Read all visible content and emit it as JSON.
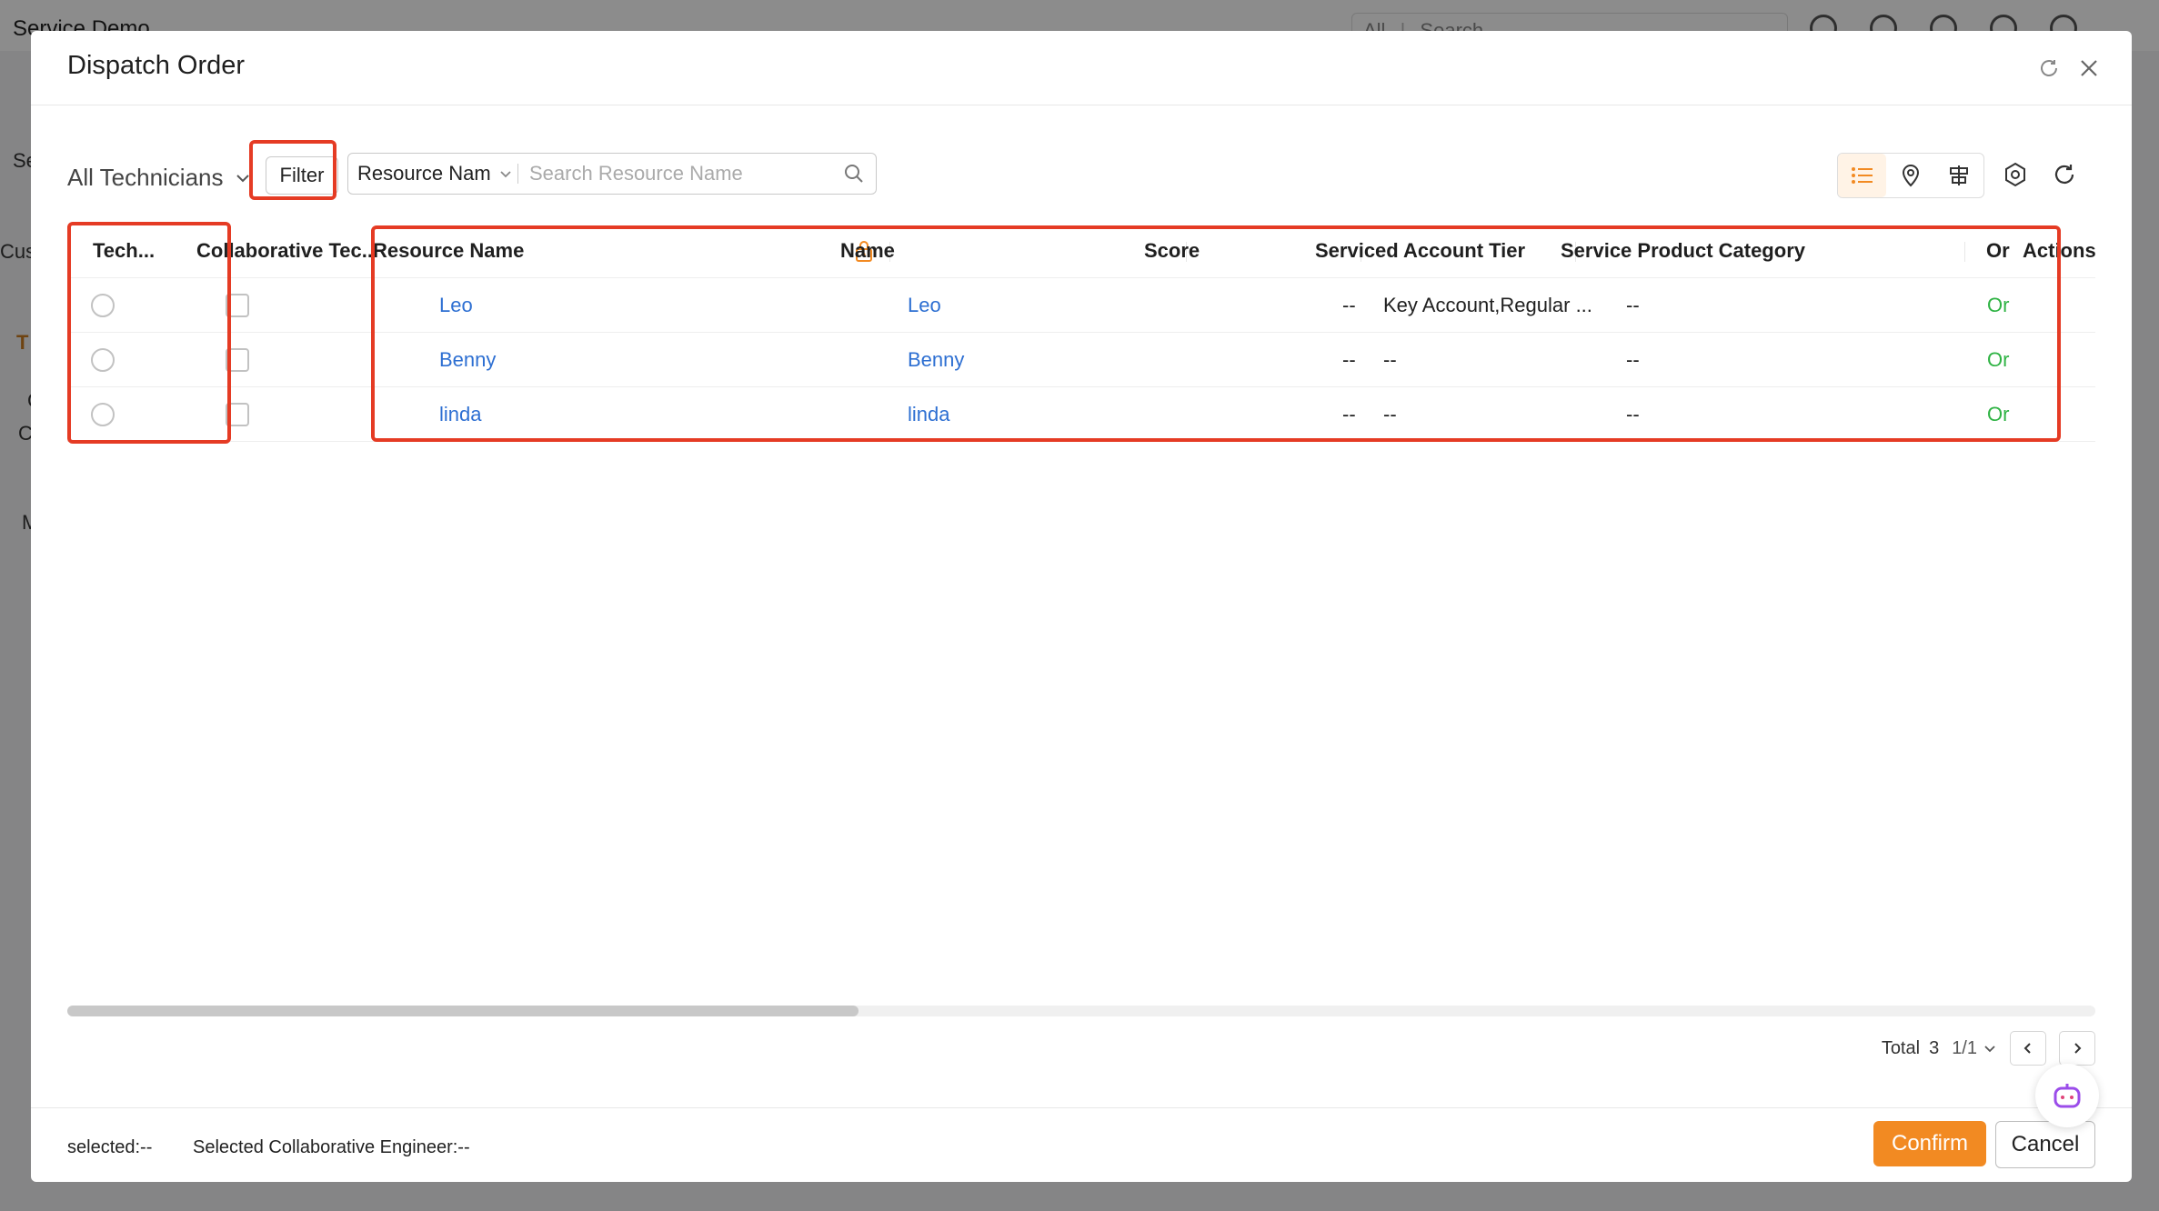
{
  "background": {
    "app_title": "Service Demo",
    "search_scope": "All",
    "search_placeholder": "Search",
    "side_fragments": [
      "Se",
      "Cus",
      "T",
      "C",
      "C",
      "M"
    ]
  },
  "modal": {
    "title": "Dispatch Order"
  },
  "toolbar": {
    "technician_filter": "All Technicians",
    "filter_label": "Filter",
    "search_field": "Resource Nam",
    "search_placeholder": "Search Resource Name",
    "view_modes": [
      "list-view-icon",
      "map-pin-icon",
      "gantt-view-icon"
    ],
    "active_view": "list-view-icon"
  },
  "table": {
    "headers": {
      "tech": "Tech...",
      "collab": "Collaborative Tec...",
      "resource_name": "Resource Name",
      "name": "Name",
      "score": "Score",
      "tier": "Serviced Account Tier",
      "category": "Service Product Category",
      "online": "Or",
      "actions": "Actions"
    },
    "rows": [
      {
        "resource_name": "Leo",
        "name": "Leo",
        "score": "--",
        "tier": "Key Account,Regular ...",
        "category": "--",
        "online": "Or"
      },
      {
        "resource_name": "Benny",
        "name": "Benny",
        "score": "--",
        "tier": "--",
        "category": "--",
        "online": "Or"
      },
      {
        "resource_name": "linda",
        "name": "linda",
        "score": "--",
        "tier": "--",
        "category": "--",
        "online": "Or"
      }
    ]
  },
  "pager": {
    "total_label": "Total",
    "total": "3",
    "page": "1/1"
  },
  "footer": {
    "selected": "selected:--",
    "selected_collab": "Selected Collaborative Engineer:--",
    "confirm": "Confirm",
    "cancel": "Cancel"
  },
  "colors": {
    "accent": "#f28a22",
    "link": "#2d6fd2",
    "online": "#2fb344",
    "highlight_box": "#e53b24"
  }
}
